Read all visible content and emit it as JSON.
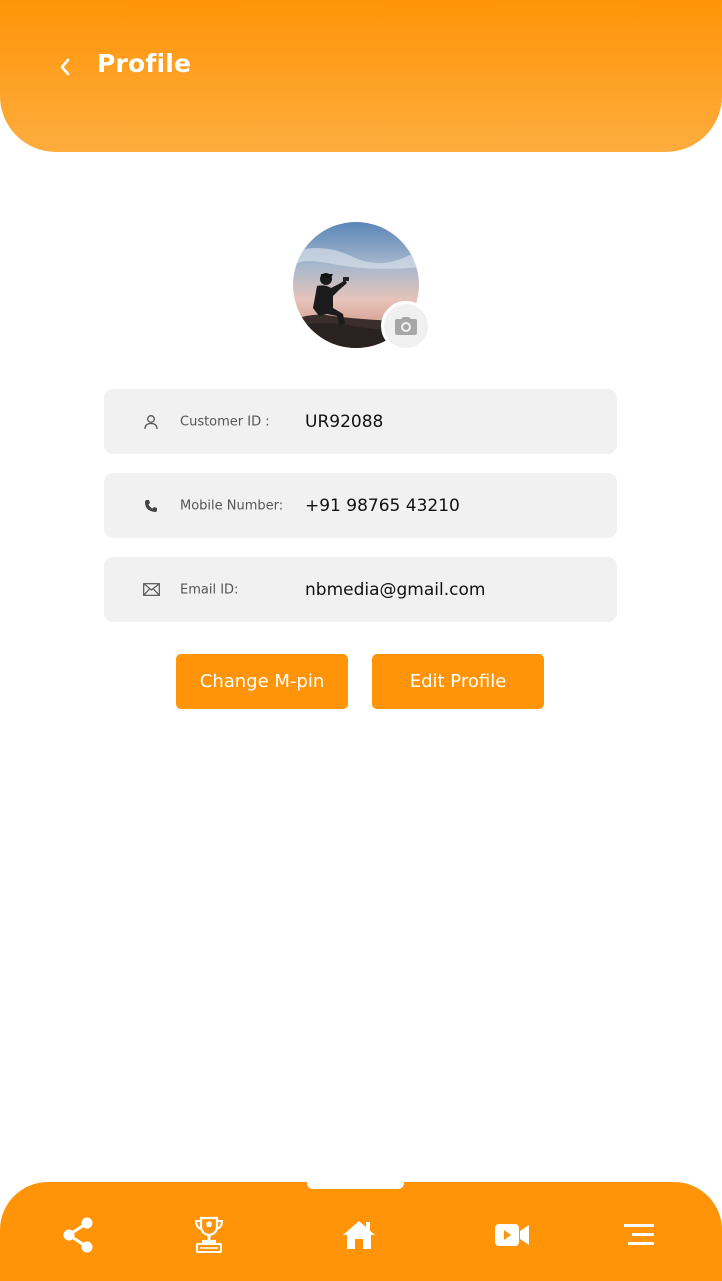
{
  "header": {
    "title": "Profile",
    "back_icon": "chevron-left-icon"
  },
  "avatar": {
    "camera_icon": "camera-icon"
  },
  "fields": [
    {
      "icon": "user-icon",
      "label": "Customer ID :",
      "value": "UR92088"
    },
    {
      "icon": "phone-icon",
      "label": "Mobile Number:",
      "value": "+91 98765 43210"
    },
    {
      "icon": "mail-icon",
      "label": "Email ID:",
      "value": "nbmedia@gmail.com"
    }
  ],
  "buttons": {
    "change_mpin": "Change M-pin",
    "edit_profile": "Edit Profile"
  },
  "bottom_nav": {
    "items": [
      "share-icon",
      "trophy-icon",
      "home-icon",
      "video-icon",
      "menu-icon"
    ]
  },
  "colors": {
    "accent": "#ff9408",
    "field_bg": "#f1f1f1"
  }
}
